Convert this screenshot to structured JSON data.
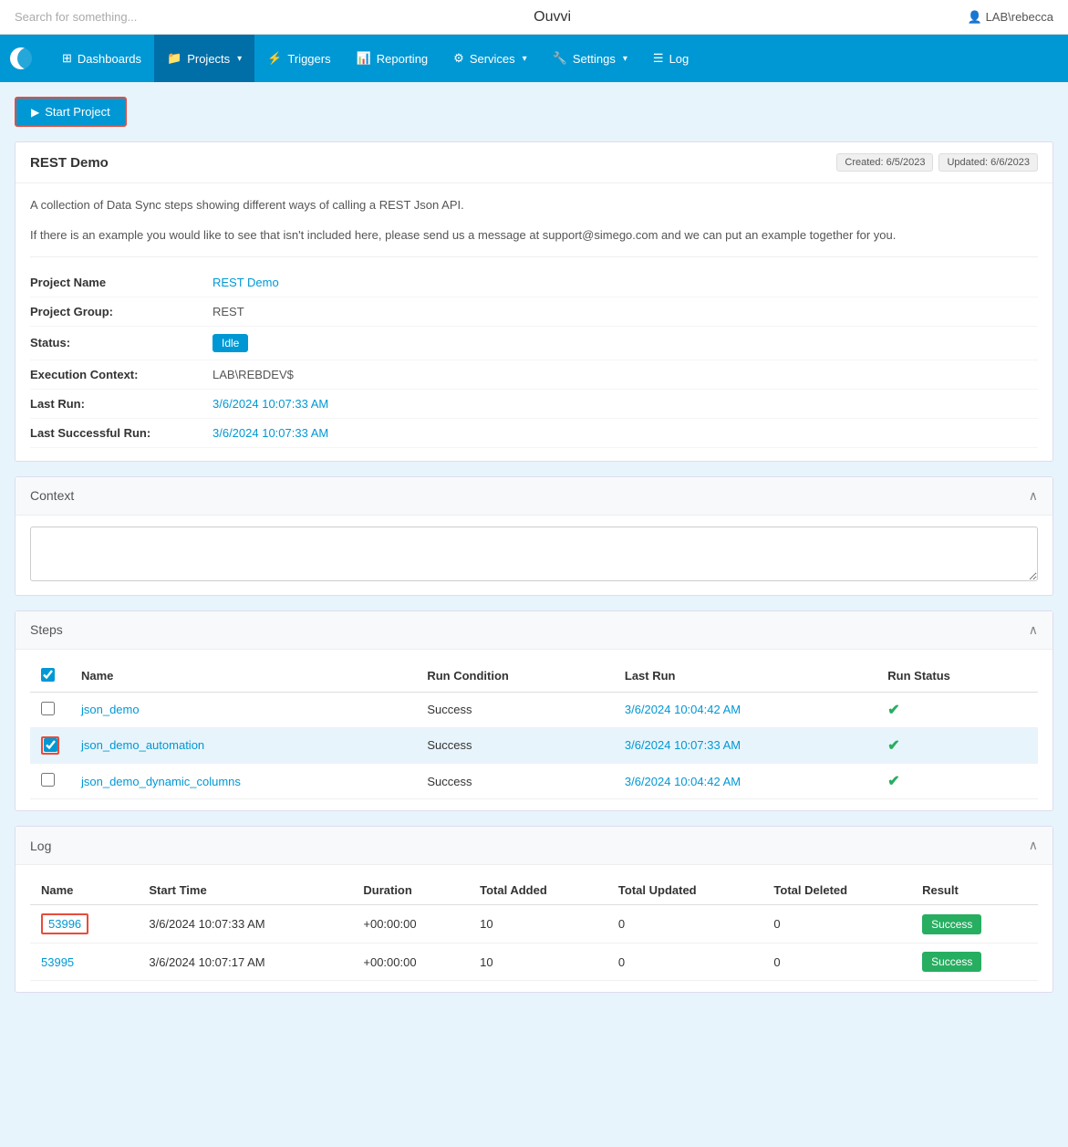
{
  "topBar": {
    "searchPlaceholder": "Search for something...",
    "appTitle": "Ouvvi",
    "user": "LAB\\rebecca"
  },
  "nav": {
    "items": [
      {
        "id": "dashboards",
        "label": "Dashboards",
        "icon": "grid",
        "active": false,
        "hasDropdown": false
      },
      {
        "id": "projects",
        "label": "Projects",
        "icon": "folder",
        "active": true,
        "hasDropdown": true
      },
      {
        "id": "triggers",
        "label": "Triggers",
        "icon": "lightning",
        "active": false,
        "hasDropdown": false
      },
      {
        "id": "reporting",
        "label": "Reporting",
        "icon": "chart",
        "active": false,
        "hasDropdown": false
      },
      {
        "id": "services",
        "label": "Services",
        "icon": "cog-group",
        "active": false,
        "hasDropdown": true
      },
      {
        "id": "settings",
        "label": "Settings",
        "icon": "wrench",
        "active": false,
        "hasDropdown": true
      },
      {
        "id": "log",
        "label": "Log",
        "icon": "list",
        "active": false,
        "hasDropdown": false
      }
    ]
  },
  "startProjectButton": "Start Project",
  "projectCard": {
    "title": "REST Demo",
    "createdBadge": "Created: 6/5/2023",
    "updatedBadge": "Updated: 6/6/2023",
    "description1": "A collection of Data Sync steps showing different ways of calling a REST Json API.",
    "description2": "If there is an example you would like to see that isn't included here, please send us a message at support@simego.com and we can put an example together for you."
  },
  "projectInfo": {
    "rows": [
      {
        "label": "Project Name",
        "value": "REST Demo",
        "type": "link"
      },
      {
        "label": "Project Group:",
        "value": "REST",
        "type": "text"
      },
      {
        "label": "Status:",
        "value": "Idle",
        "type": "status"
      },
      {
        "label": "Execution Context:",
        "value": "LAB\\REBDEV$",
        "type": "text"
      },
      {
        "label": "Last Run:",
        "value": "3/6/2024 10:07:33 AM",
        "type": "link"
      },
      {
        "label": "Last Successful Run:",
        "value": "3/6/2024 10:07:33 AM",
        "type": "link"
      }
    ]
  },
  "contextSection": {
    "title": "Context",
    "textareaValue": ""
  },
  "stepsSection": {
    "title": "Steps",
    "columns": [
      "",
      "Name",
      "Run Condition",
      "Last Run",
      "Run Status"
    ],
    "rows": [
      {
        "checked": false,
        "name": "json_demo",
        "runCondition": "Success",
        "lastRun": "3/6/2024 10:04:42 AM",
        "status": "success",
        "highlighted": false
      },
      {
        "checked": true,
        "name": "json_demo_automation",
        "runCondition": "Success",
        "lastRun": "3/6/2024 10:07:33 AM",
        "status": "success",
        "highlighted": true
      },
      {
        "checked": false,
        "name": "json_demo_dynamic_columns",
        "runCondition": "Success",
        "lastRun": "3/6/2024 10:04:42 AM",
        "status": "success",
        "highlighted": false
      }
    ]
  },
  "logSection": {
    "title": "Log",
    "columns": [
      "Name",
      "Start Time",
      "Duration",
      "Total Added",
      "Total Updated",
      "Total Deleted",
      "Result"
    ],
    "rows": [
      {
        "id": "53996",
        "startTime": "3/6/2024 10:07:33 AM",
        "duration": "+00:00:00",
        "totalAdded": "10",
        "totalUpdated": "0",
        "totalDeleted": "0",
        "result": "Success",
        "highlighted": true
      },
      {
        "id": "53995",
        "startTime": "3/6/2024 10:07:17 AM",
        "duration": "+00:00:00",
        "totalAdded": "10",
        "totalUpdated": "0",
        "totalDeleted": "0",
        "result": "Success",
        "highlighted": false
      }
    ]
  }
}
